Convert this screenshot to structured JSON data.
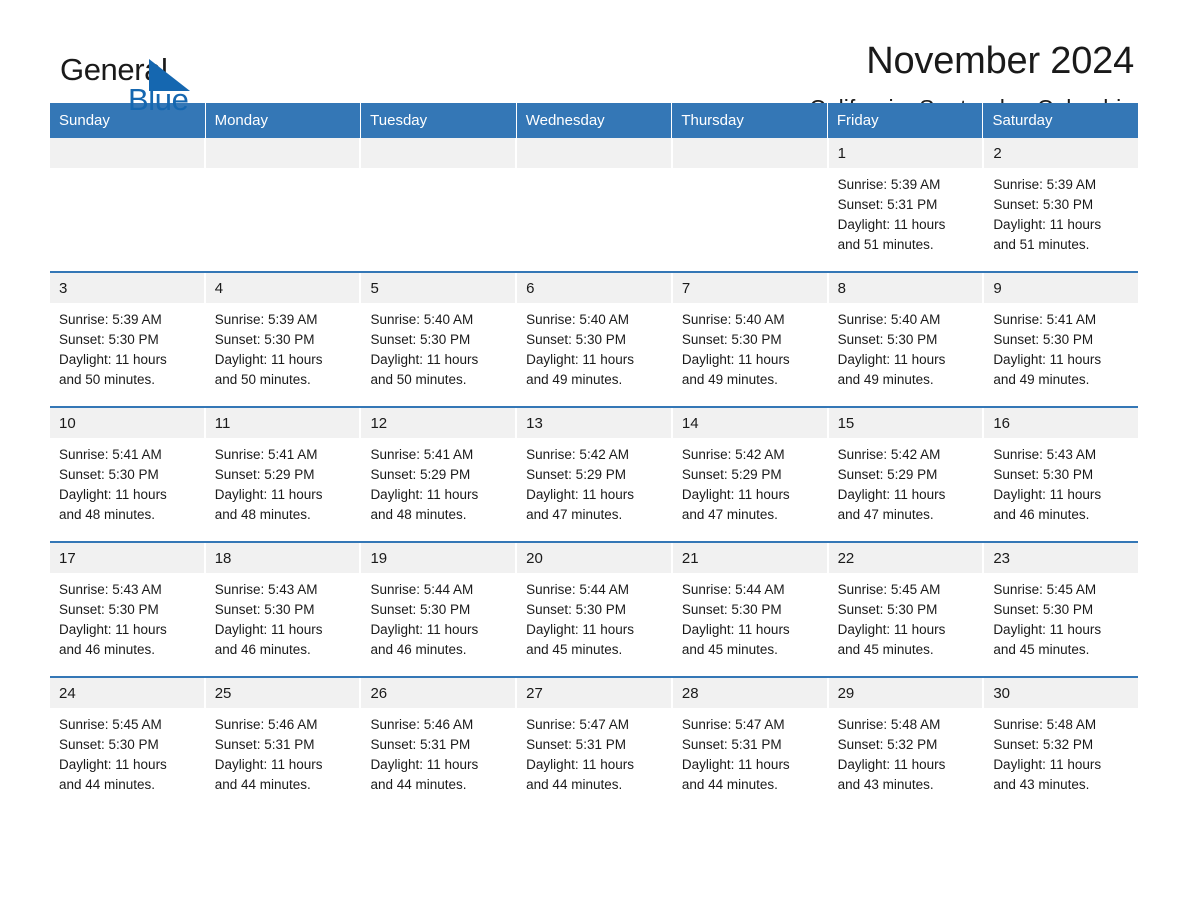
{
  "brand": {
    "name_part1": "General",
    "name_part2": "Blue",
    "accent_color": "#1567b0"
  },
  "header": {
    "month_title": "November 2024",
    "location": "California, Santander, Colombia"
  },
  "calendar": {
    "header_bg": "#3477b6",
    "day_band_bg": "#f1f1f1",
    "weekdays": [
      "Sunday",
      "Monday",
      "Tuesday",
      "Wednesday",
      "Thursday",
      "Friday",
      "Saturday"
    ],
    "weeks": [
      [
        {
          "day": "",
          "lines": []
        },
        {
          "day": "",
          "lines": []
        },
        {
          "day": "",
          "lines": []
        },
        {
          "day": "",
          "lines": []
        },
        {
          "day": "",
          "lines": []
        },
        {
          "day": "1",
          "lines": [
            "Sunrise: 5:39 AM",
            "Sunset: 5:31 PM",
            "Daylight: 11 hours",
            "and 51 minutes."
          ]
        },
        {
          "day": "2",
          "lines": [
            "Sunrise: 5:39 AM",
            "Sunset: 5:30 PM",
            "Daylight: 11 hours",
            "and 51 minutes."
          ]
        }
      ],
      [
        {
          "day": "3",
          "lines": [
            "Sunrise: 5:39 AM",
            "Sunset: 5:30 PM",
            "Daylight: 11 hours",
            "and 50 minutes."
          ]
        },
        {
          "day": "4",
          "lines": [
            "Sunrise: 5:39 AM",
            "Sunset: 5:30 PM",
            "Daylight: 11 hours",
            "and 50 minutes."
          ]
        },
        {
          "day": "5",
          "lines": [
            "Sunrise: 5:40 AM",
            "Sunset: 5:30 PM",
            "Daylight: 11 hours",
            "and 50 minutes."
          ]
        },
        {
          "day": "6",
          "lines": [
            "Sunrise: 5:40 AM",
            "Sunset: 5:30 PM",
            "Daylight: 11 hours",
            "and 49 minutes."
          ]
        },
        {
          "day": "7",
          "lines": [
            "Sunrise: 5:40 AM",
            "Sunset: 5:30 PM",
            "Daylight: 11 hours",
            "and 49 minutes."
          ]
        },
        {
          "day": "8",
          "lines": [
            "Sunrise: 5:40 AM",
            "Sunset: 5:30 PM",
            "Daylight: 11 hours",
            "and 49 minutes."
          ]
        },
        {
          "day": "9",
          "lines": [
            "Sunrise: 5:41 AM",
            "Sunset: 5:30 PM",
            "Daylight: 11 hours",
            "and 49 minutes."
          ]
        }
      ],
      [
        {
          "day": "10",
          "lines": [
            "Sunrise: 5:41 AM",
            "Sunset: 5:30 PM",
            "Daylight: 11 hours",
            "and 48 minutes."
          ]
        },
        {
          "day": "11",
          "lines": [
            "Sunrise: 5:41 AM",
            "Sunset: 5:29 PM",
            "Daylight: 11 hours",
            "and 48 minutes."
          ]
        },
        {
          "day": "12",
          "lines": [
            "Sunrise: 5:41 AM",
            "Sunset: 5:29 PM",
            "Daylight: 11 hours",
            "and 48 minutes."
          ]
        },
        {
          "day": "13",
          "lines": [
            "Sunrise: 5:42 AM",
            "Sunset: 5:29 PM",
            "Daylight: 11 hours",
            "and 47 minutes."
          ]
        },
        {
          "day": "14",
          "lines": [
            "Sunrise: 5:42 AM",
            "Sunset: 5:29 PM",
            "Daylight: 11 hours",
            "and 47 minutes."
          ]
        },
        {
          "day": "15",
          "lines": [
            "Sunrise: 5:42 AM",
            "Sunset: 5:29 PM",
            "Daylight: 11 hours",
            "and 47 minutes."
          ]
        },
        {
          "day": "16",
          "lines": [
            "Sunrise: 5:43 AM",
            "Sunset: 5:30 PM",
            "Daylight: 11 hours",
            "and 46 minutes."
          ]
        }
      ],
      [
        {
          "day": "17",
          "lines": [
            "Sunrise: 5:43 AM",
            "Sunset: 5:30 PM",
            "Daylight: 11 hours",
            "and 46 minutes."
          ]
        },
        {
          "day": "18",
          "lines": [
            "Sunrise: 5:43 AM",
            "Sunset: 5:30 PM",
            "Daylight: 11 hours",
            "and 46 minutes."
          ]
        },
        {
          "day": "19",
          "lines": [
            "Sunrise: 5:44 AM",
            "Sunset: 5:30 PM",
            "Daylight: 11 hours",
            "and 46 minutes."
          ]
        },
        {
          "day": "20",
          "lines": [
            "Sunrise: 5:44 AM",
            "Sunset: 5:30 PM",
            "Daylight: 11 hours",
            "and 45 minutes."
          ]
        },
        {
          "day": "21",
          "lines": [
            "Sunrise: 5:44 AM",
            "Sunset: 5:30 PM",
            "Daylight: 11 hours",
            "and 45 minutes."
          ]
        },
        {
          "day": "22",
          "lines": [
            "Sunrise: 5:45 AM",
            "Sunset: 5:30 PM",
            "Daylight: 11 hours",
            "and 45 minutes."
          ]
        },
        {
          "day": "23",
          "lines": [
            "Sunrise: 5:45 AM",
            "Sunset: 5:30 PM",
            "Daylight: 11 hours",
            "and 45 minutes."
          ]
        }
      ],
      [
        {
          "day": "24",
          "lines": [
            "Sunrise: 5:45 AM",
            "Sunset: 5:30 PM",
            "Daylight: 11 hours",
            "and 44 minutes."
          ]
        },
        {
          "day": "25",
          "lines": [
            "Sunrise: 5:46 AM",
            "Sunset: 5:31 PM",
            "Daylight: 11 hours",
            "and 44 minutes."
          ]
        },
        {
          "day": "26",
          "lines": [
            "Sunrise: 5:46 AM",
            "Sunset: 5:31 PM",
            "Daylight: 11 hours",
            "and 44 minutes."
          ]
        },
        {
          "day": "27",
          "lines": [
            "Sunrise: 5:47 AM",
            "Sunset: 5:31 PM",
            "Daylight: 11 hours",
            "and 44 minutes."
          ]
        },
        {
          "day": "28",
          "lines": [
            "Sunrise: 5:47 AM",
            "Sunset: 5:31 PM",
            "Daylight: 11 hours",
            "and 44 minutes."
          ]
        },
        {
          "day": "29",
          "lines": [
            "Sunrise: 5:48 AM",
            "Sunset: 5:32 PM",
            "Daylight: 11 hours",
            "and 43 minutes."
          ]
        },
        {
          "day": "30",
          "lines": [
            "Sunrise: 5:48 AM",
            "Sunset: 5:32 PM",
            "Daylight: 11 hours",
            "and 43 minutes."
          ]
        }
      ]
    ]
  }
}
